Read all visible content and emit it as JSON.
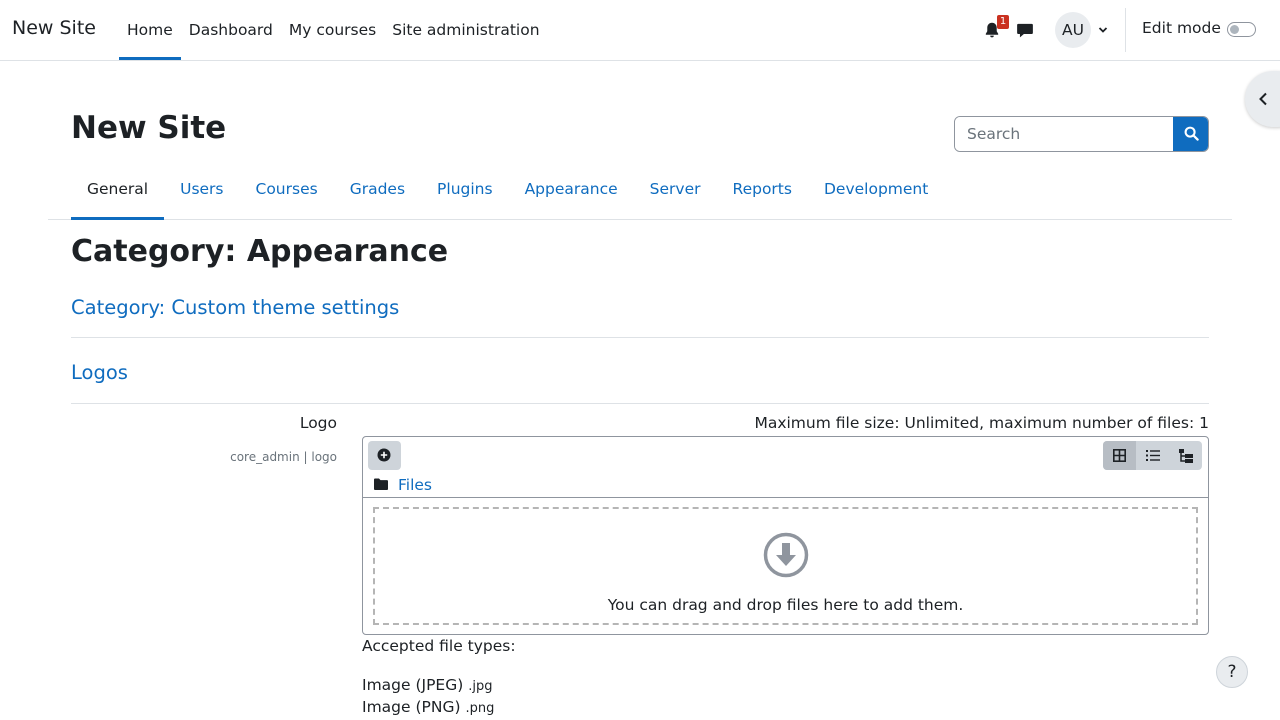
{
  "navbar": {
    "brand": "New Site",
    "items": [
      {
        "label": "Home"
      },
      {
        "label": "Dashboard"
      },
      {
        "label": "My courses"
      },
      {
        "label": "Site administration"
      }
    ],
    "active_item": "Home",
    "notification_count": "1",
    "user_initials": "AU",
    "edit_mode_label": "Edit mode",
    "edit_mode_on": false,
    "icons": [
      "bell-icon",
      "chat-icon",
      "chevron-down-icon"
    ]
  },
  "header": {
    "title": "New Site",
    "search": {
      "placeholder": "Search"
    }
  },
  "secondary_nav": {
    "tabs": [
      {
        "label": "General"
      },
      {
        "label": "Users"
      },
      {
        "label": "Courses"
      },
      {
        "label": "Grades"
      },
      {
        "label": "Plugins"
      },
      {
        "label": "Appearance"
      },
      {
        "label": "Server"
      },
      {
        "label": "Reports"
      },
      {
        "label": "Development"
      }
    ],
    "active_tab": "General"
  },
  "content": {
    "heading": "Category: Appearance",
    "subcategory_link": "Category: Custom theme settings",
    "section_heading": "Logos",
    "setting": {
      "label": "Logo",
      "key": "core_admin | logo",
      "max_size_text": "Maximum file size: Unlimited, maximum number of files: 1",
      "path_label": "Files",
      "drop_text": "You can drag and drop files here to add them.",
      "accepted_title": "Accepted file types:",
      "file_types": [
        {
          "name": "Image (JPEG)",
          "ext": ".jpg"
        },
        {
          "name": "Image (PNG)",
          "ext": ".png"
        }
      ]
    }
  },
  "help_button": "?",
  "colors": {
    "link": "#0f6cbf",
    "text": "#1d2125",
    "badge": "#ca3120"
  }
}
